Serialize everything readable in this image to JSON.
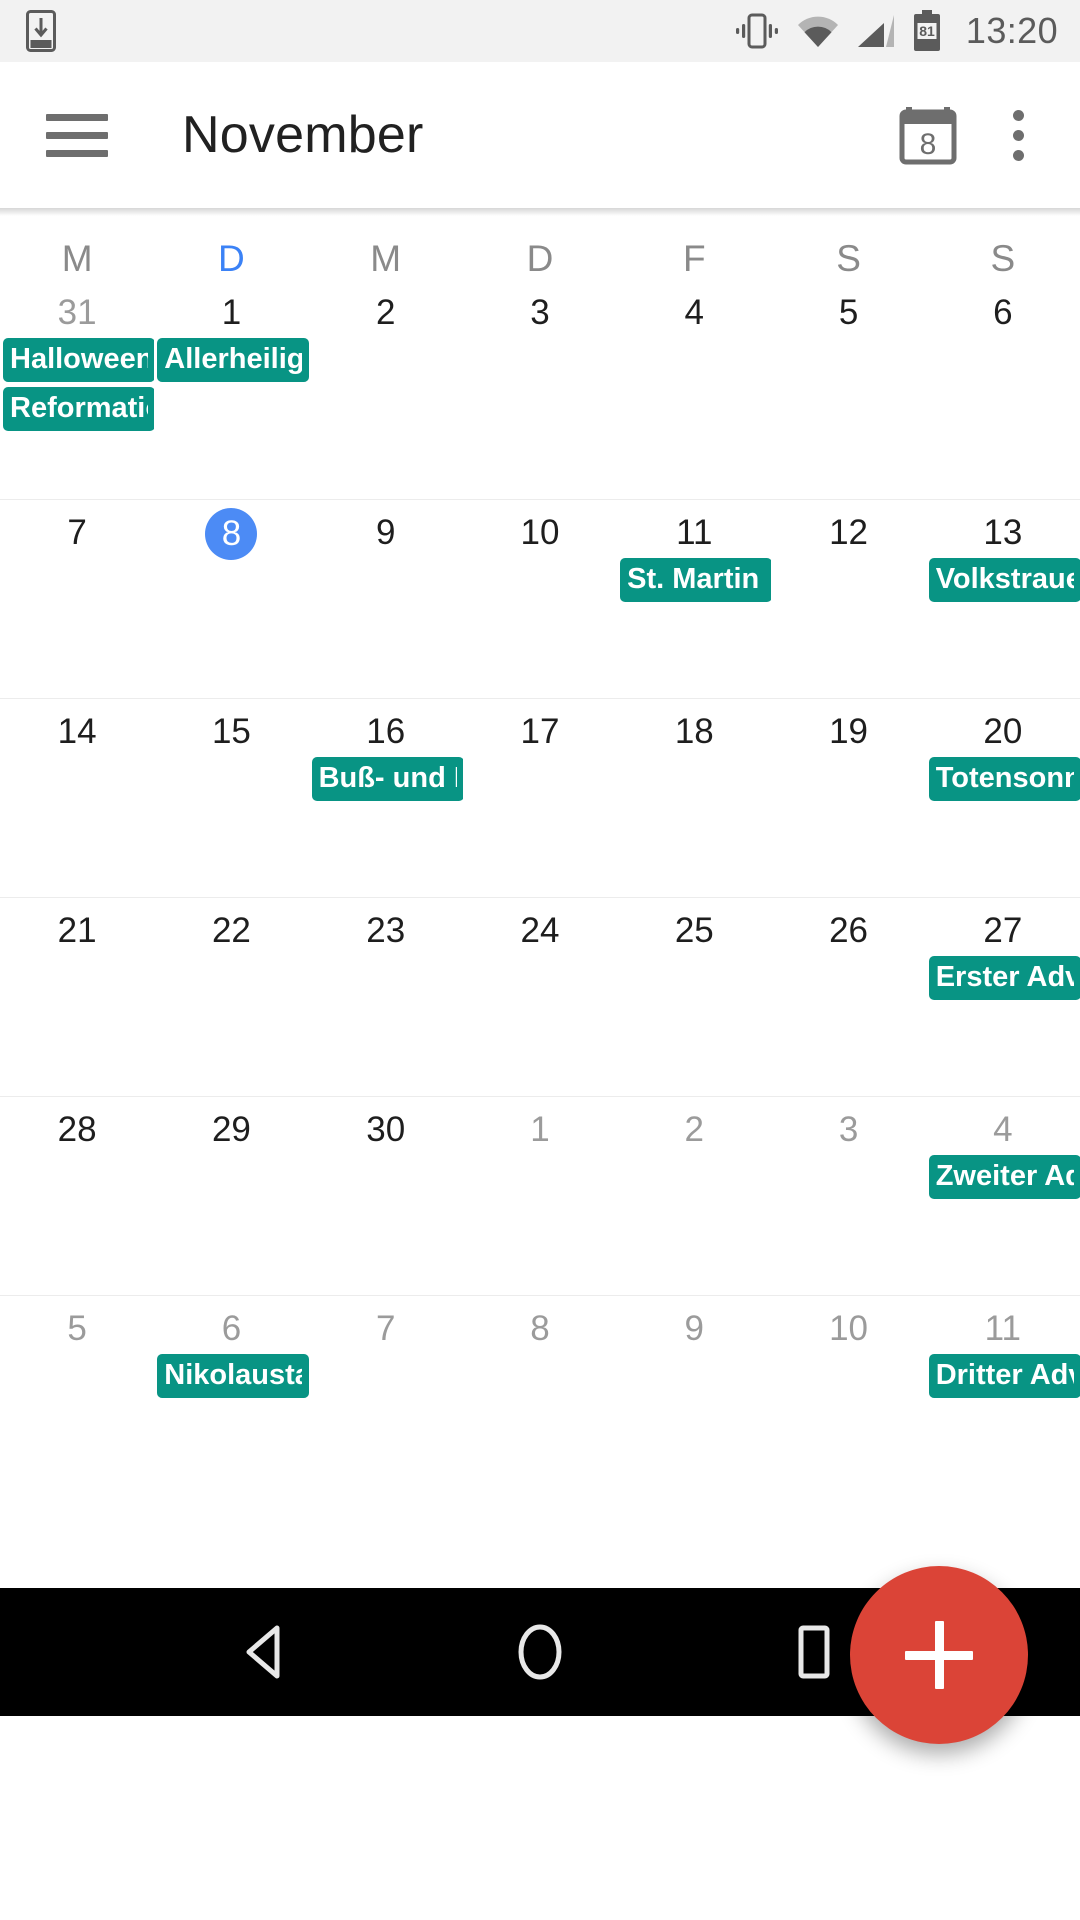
{
  "status_bar": {
    "download_icon": "download-to-device-icon",
    "vibrate_icon": "vibrate-icon",
    "wifi_icon": "wifi-icon",
    "signal_icon": "cellular-signal-icon",
    "battery_icon": "battery-icon",
    "battery_level": "81",
    "clock": "13:20"
  },
  "app_bar": {
    "menu_icon": "hamburger-menu-icon",
    "title": "November",
    "today_icon": "calendar-today-icon",
    "today_day_number": "8",
    "overflow_icon": "overflow-menu-icon"
  },
  "calendar": {
    "weekday_headers": [
      {
        "label": "M",
        "is_today_column": false
      },
      {
        "label": "D",
        "is_today_column": true
      },
      {
        "label": "M",
        "is_today_column": false
      },
      {
        "label": "D",
        "is_today_column": false
      },
      {
        "label": "F",
        "is_today_column": false
      },
      {
        "label": "S",
        "is_today_column": false
      },
      {
        "label": "S",
        "is_today_column": false
      }
    ],
    "weeks": [
      {
        "days": [
          {
            "num": "31",
            "muted": true,
            "today": false,
            "events": [
              "Halloween",
              "Reformationstag"
            ]
          },
          {
            "num": "1",
            "muted": false,
            "today": false,
            "events": [
              "Allerheiligen"
            ]
          },
          {
            "num": "2",
            "muted": false,
            "today": false,
            "events": []
          },
          {
            "num": "3",
            "muted": false,
            "today": false,
            "events": []
          },
          {
            "num": "4",
            "muted": false,
            "today": false,
            "events": []
          },
          {
            "num": "5",
            "muted": false,
            "today": false,
            "events": []
          },
          {
            "num": "6",
            "muted": false,
            "today": false,
            "events": []
          }
        ]
      },
      {
        "days": [
          {
            "num": "7",
            "muted": false,
            "today": false,
            "events": []
          },
          {
            "num": "8",
            "muted": false,
            "today": true,
            "events": []
          },
          {
            "num": "9",
            "muted": false,
            "today": false,
            "events": []
          },
          {
            "num": "10",
            "muted": false,
            "today": false,
            "events": []
          },
          {
            "num": "11",
            "muted": false,
            "today": false,
            "events": [
              "St. Martin"
            ]
          },
          {
            "num": "12",
            "muted": false,
            "today": false,
            "events": []
          },
          {
            "num": "13",
            "muted": false,
            "today": false,
            "events": [
              "Volkstrauertag"
            ]
          }
        ]
      },
      {
        "days": [
          {
            "num": "14",
            "muted": false,
            "today": false,
            "events": []
          },
          {
            "num": "15",
            "muted": false,
            "today": false,
            "events": []
          },
          {
            "num": "16",
            "muted": false,
            "today": false,
            "events": [
              "Buß- und Bettag"
            ]
          },
          {
            "num": "17",
            "muted": false,
            "today": false,
            "events": []
          },
          {
            "num": "18",
            "muted": false,
            "today": false,
            "events": []
          },
          {
            "num": "19",
            "muted": false,
            "today": false,
            "events": []
          },
          {
            "num": "20",
            "muted": false,
            "today": false,
            "events": [
              "Totensonntag"
            ]
          }
        ]
      },
      {
        "days": [
          {
            "num": "21",
            "muted": false,
            "today": false,
            "events": []
          },
          {
            "num": "22",
            "muted": false,
            "today": false,
            "events": []
          },
          {
            "num": "23",
            "muted": false,
            "today": false,
            "events": []
          },
          {
            "num": "24",
            "muted": false,
            "today": false,
            "events": []
          },
          {
            "num": "25",
            "muted": false,
            "today": false,
            "events": []
          },
          {
            "num": "26",
            "muted": false,
            "today": false,
            "events": []
          },
          {
            "num": "27",
            "muted": false,
            "today": false,
            "events": [
              "Erster Advent"
            ]
          }
        ]
      },
      {
        "days": [
          {
            "num": "28",
            "muted": false,
            "today": false,
            "events": []
          },
          {
            "num": "29",
            "muted": false,
            "today": false,
            "events": []
          },
          {
            "num": "30",
            "muted": false,
            "today": false,
            "events": []
          },
          {
            "num": "1",
            "muted": true,
            "today": false,
            "events": []
          },
          {
            "num": "2",
            "muted": true,
            "today": false,
            "events": []
          },
          {
            "num": "3",
            "muted": true,
            "today": false,
            "events": []
          },
          {
            "num": "4",
            "muted": true,
            "today": false,
            "events": [
              "Zweiter Advent"
            ]
          }
        ]
      },
      {
        "days": [
          {
            "num": "5",
            "muted": true,
            "today": false,
            "events": []
          },
          {
            "num": "6",
            "muted": true,
            "today": false,
            "events": [
              "Nikolaustag"
            ]
          },
          {
            "num": "7",
            "muted": true,
            "today": false,
            "events": []
          },
          {
            "num": "8",
            "muted": true,
            "today": false,
            "events": []
          },
          {
            "num": "9",
            "muted": true,
            "today": false,
            "events": []
          },
          {
            "num": "10",
            "muted": true,
            "today": false,
            "events": []
          },
          {
            "num": "11",
            "muted": true,
            "today": false,
            "events": [
              "Dritter Advent"
            ]
          }
        ]
      }
    ]
  },
  "fab": {
    "icon": "plus-icon",
    "label": "Add event"
  },
  "nav_bar": {
    "back_icon": "back-triangle-icon",
    "home_icon": "home-circle-icon",
    "recents_icon": "recents-square-icon"
  },
  "colors": {
    "event_chip": "#089484",
    "today_highlight": "#4c8bf5",
    "fab": "#db4437",
    "status_bar_bg": "#f2f2f2",
    "nav_bar_bg": "#000000"
  }
}
